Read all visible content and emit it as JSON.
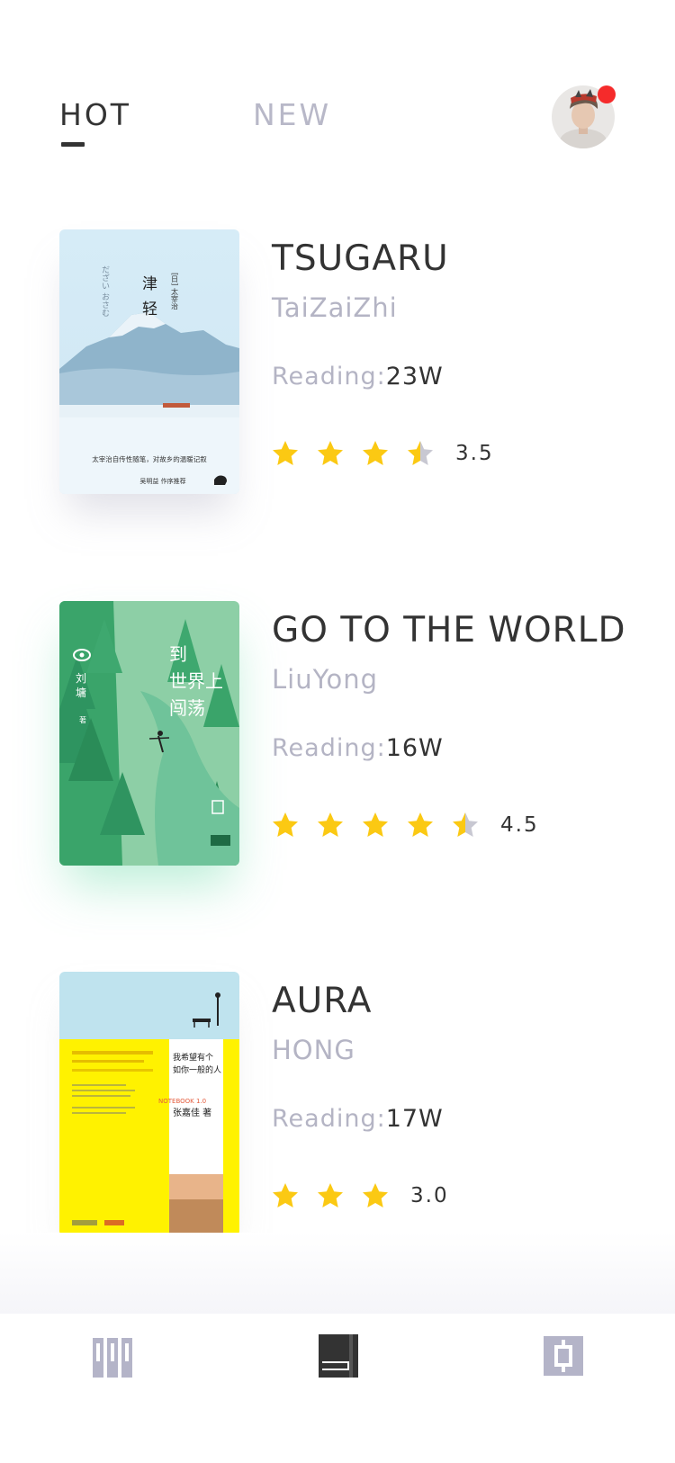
{
  "tabs": [
    {
      "label": "HOT",
      "active": true
    },
    {
      "label": "NEW",
      "active": false
    }
  ],
  "profile": {
    "avatar": "user-avatar",
    "notification": true
  },
  "books": [
    {
      "title": "TSUGARU",
      "author": "TaiZaiZhi",
      "reading_label": "Reading:",
      "reading_value": "23W",
      "rating": 3.5,
      "rating_text": "3.5",
      "cover": {
        "title_cn": "津轻",
        "author_cn": "[日] 太宰治 著",
        "vertical_jp": "だざい おさむ",
        "tagline": "太宰治自传性随笔，对故乡的温暖记叙",
        "recommend": "吴明益 作序推荐"
      }
    },
    {
      "title": "GO TO THE WORLD",
      "author": "LiuYong",
      "reading_label": "Reading:",
      "reading_value": "16W",
      "rating": 4.5,
      "rating_text": "4.5",
      "cover": {
        "title_cn": "到世界上闯荡",
        "author_cn": "刘墉",
        "author_suffix": "著"
      }
    },
    {
      "title": "AURA",
      "author": "HONG",
      "reading_label": "Reading:",
      "reading_value": "17W",
      "rating": 3.0,
      "rating_text": "3.0",
      "cover": {
        "title_cn": "我希望有个如你一般的人",
        "notebook": "NOTEBOOK 1.0",
        "author_cn": "张嘉佳 著"
      }
    }
  ],
  "bottom_nav": [
    {
      "icon": "library-icon",
      "active": false
    },
    {
      "icon": "book-icon",
      "active": true
    },
    {
      "icon": "settings-icon",
      "active": false
    }
  ],
  "colors": {
    "star": "#fbc913",
    "star_empty": "#c8c8d2",
    "text_primary": "#333333",
    "text_muted": "#b4b4c4",
    "nav_inactive": "#b4b4c8",
    "nav_active": "#333333",
    "badge": "#f52b2b"
  }
}
